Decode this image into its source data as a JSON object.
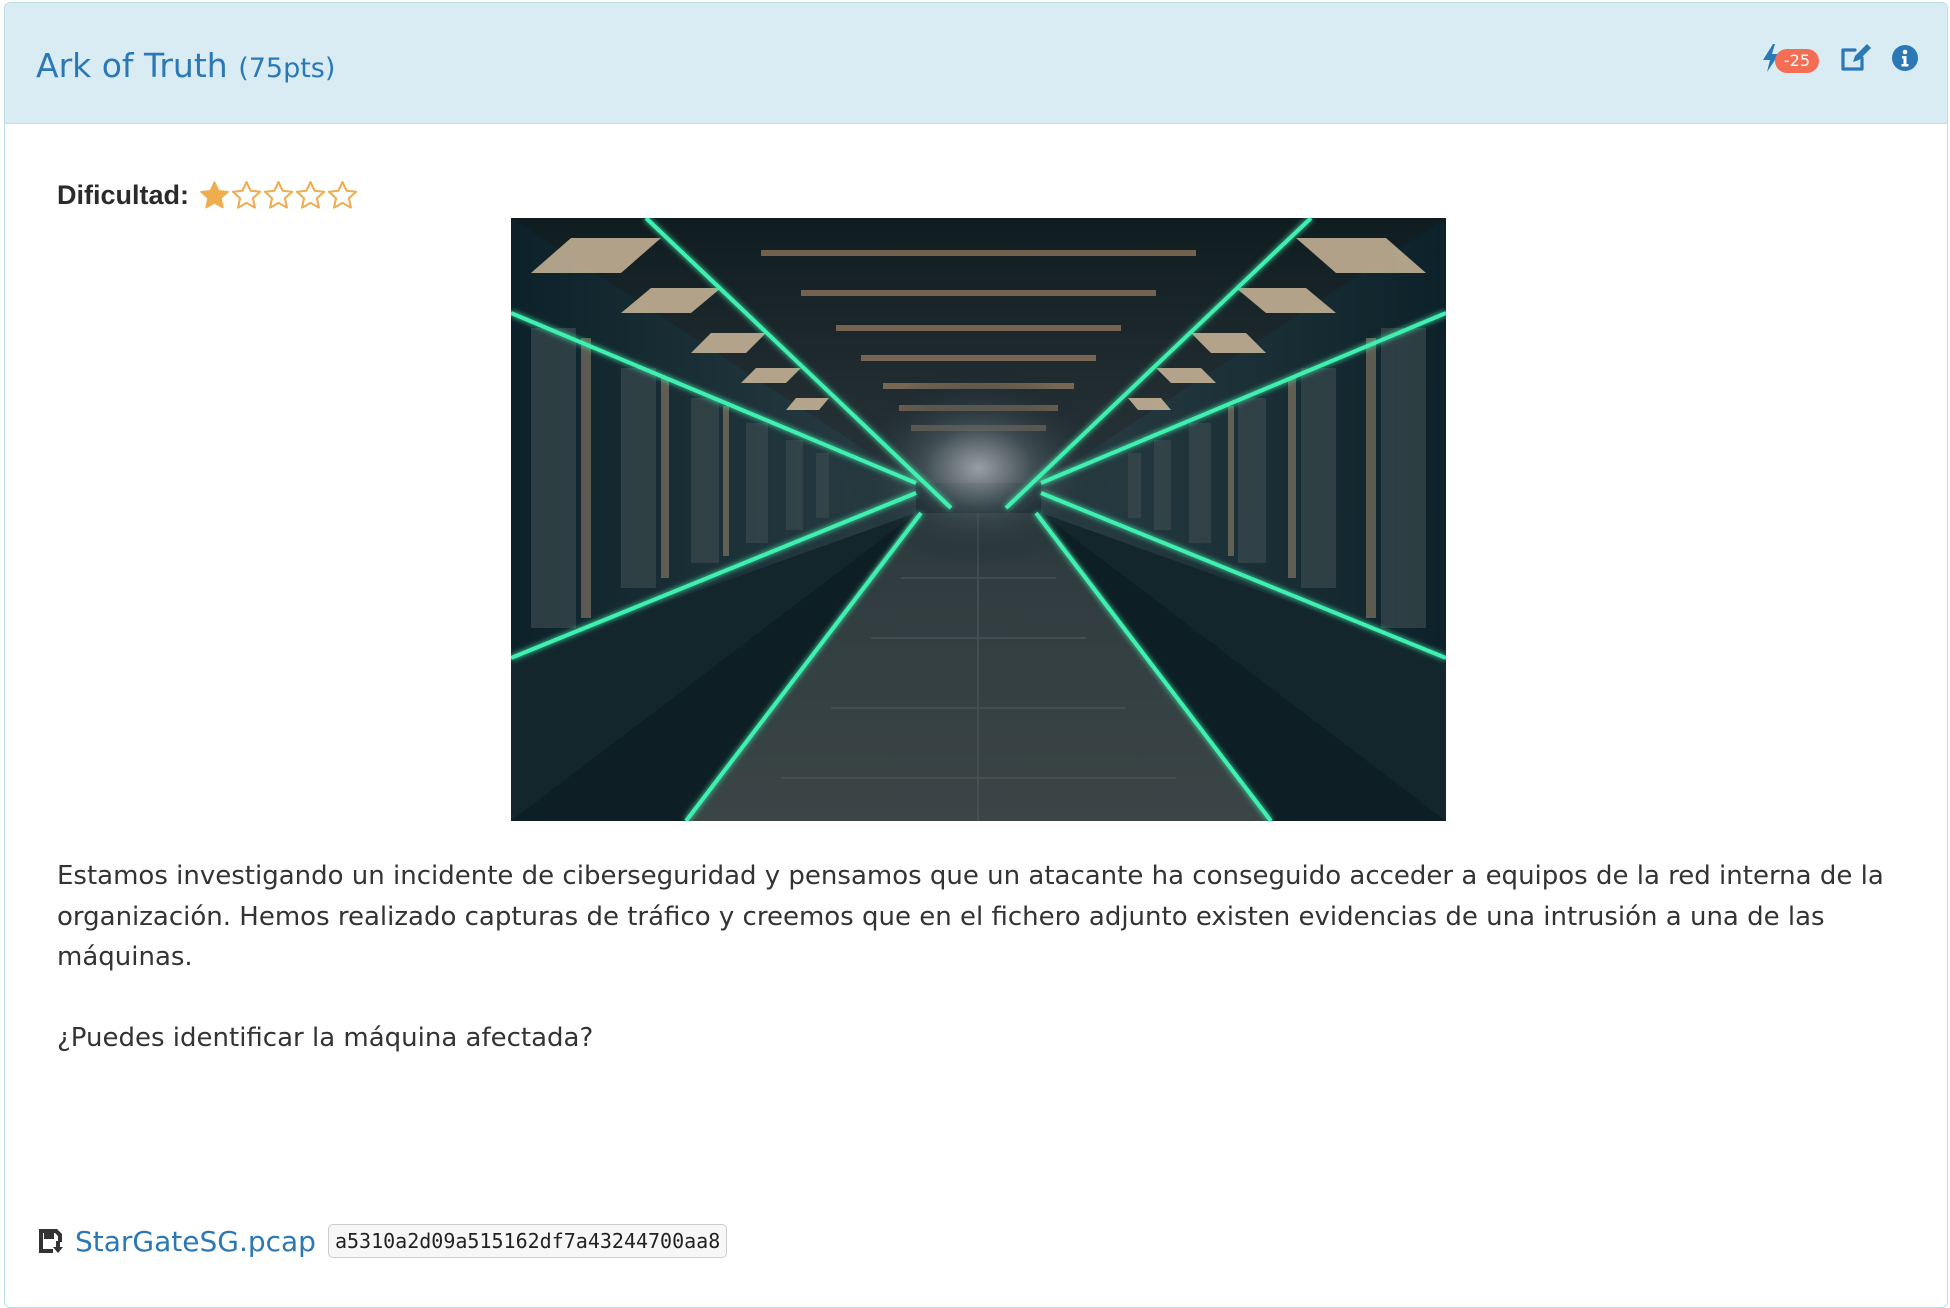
{
  "challenge": {
    "title": "Ark of Truth",
    "points": "(75pts)"
  },
  "header": {
    "hint_icon": "bolt-icon",
    "hint_penalty": "-25",
    "edit_icon": "edit-icon",
    "info_icon": "info-circle-icon"
  },
  "difficulty": {
    "label": "Dificultad:",
    "rating": 1,
    "max": 5,
    "star_color": "#f0ad4e"
  },
  "description": {
    "paragraph1": "Estamos investigando un incidente de ciberseguridad y pensamos que un atacante ha conseguido acceder a equipos de la red interna de la organización. Hemos realizado capturas de tráfico y creemos que en el fichero adjunto existen evidencias de una intrusión a una de las máquinas.",
    "paragraph2": "¿Puedes identificar la máquina afectada?"
  },
  "attachment": {
    "icon": "file-download-icon",
    "filename": "StarGateSG.pcap",
    "hash": "a5310a2d09a515162df7a43244700aa8"
  },
  "colors": {
    "header_bg": "#d9ecf4",
    "link": "#2a79b6",
    "badge": "#f36e55",
    "neon": "#3ff0b0"
  }
}
